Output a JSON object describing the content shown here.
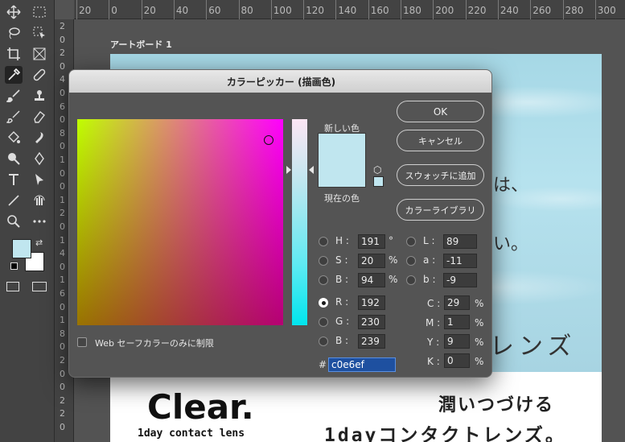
{
  "rulers": {
    "h_ticks": [
      "20",
      "0",
      "20",
      "40",
      "60",
      "80",
      "100",
      "120",
      "140",
      "160",
      "180",
      "200",
      "220",
      "240",
      "260",
      "280",
      "300"
    ],
    "v_ticks": [
      "2",
      "0",
      "2",
      "0",
      "4",
      "0",
      "6",
      "0",
      "8",
      "0",
      "1",
      "0",
      "0",
      "1",
      "2",
      "0",
      "1",
      "4",
      "0",
      "1",
      "6",
      "0",
      "1",
      "8",
      "0",
      "2",
      "0",
      "0",
      "2",
      "2",
      "0"
    ]
  },
  "artboard": {
    "label": "アートボード 1",
    "text_wa": "は、",
    "text_i": "い。",
    "text_lens": "レンズ",
    "clear": "Clear.",
    "oneday": "1day contact lens",
    "tagline1": "潤いつづける",
    "tagline2": "1dayコンタクトレンズ。"
  },
  "dialog": {
    "title": "カラーピッカー (描画色)",
    "new_label": "新しい色",
    "current_label": "現在の色",
    "buttons": {
      "ok": "OK",
      "cancel": "キャンセル",
      "add_swatch": "スウォッチに追加",
      "libraries": "カラーライブラリ"
    },
    "web_safe_label": "Web セーフカラーのみに制限",
    "hsb": [
      {
        "key": "H",
        "value": "191",
        "unit": "°",
        "selected": false
      },
      {
        "key": "S",
        "value": "20",
        "unit": "%",
        "selected": false
      },
      {
        "key": "B",
        "value": "94",
        "unit": "%",
        "selected": false
      }
    ],
    "rgb": [
      {
        "key": "R",
        "value": "192",
        "selected": true
      },
      {
        "key": "G",
        "value": "230",
        "selected": false
      },
      {
        "key": "B",
        "value": "239",
        "selected": false
      }
    ],
    "lab": [
      {
        "key": "L",
        "value": "89"
      },
      {
        "key": "a",
        "value": "-11"
      },
      {
        "key": "b",
        "value": "-9"
      }
    ],
    "cmyk": [
      {
        "key": "C",
        "value": "29",
        "unit": "%"
      },
      {
        "key": "M",
        "value": "1",
        "unit": "%"
      },
      {
        "key": "Y",
        "value": "9",
        "unit": "%"
      },
      {
        "key": "K",
        "value": "0",
        "unit": "%"
      }
    ],
    "hex_prefix": "#",
    "hex": "c0e6ef",
    "colors": {
      "current": "#c0e6ef",
      "accent": "#1e50a0"
    }
  },
  "toolbar": {
    "icons": [
      "move-icon",
      "marquee-icon",
      "lasso-icon",
      "object-select-icon",
      "crop-icon",
      "frame-icon",
      "eyedropper-icon",
      "healing-icon",
      "brush-icon",
      "stamp-icon",
      "history-brush-icon",
      "eraser-icon",
      "bucket-icon",
      "smudge-icon",
      "dodge-icon",
      "pen-icon",
      "type-icon",
      "path-select-icon",
      "line-icon",
      "hand-rotate-icon",
      "zoom-icon",
      "more-icon"
    ],
    "fg_color": "#c0e6ef",
    "bg_color": "#ffffff"
  }
}
